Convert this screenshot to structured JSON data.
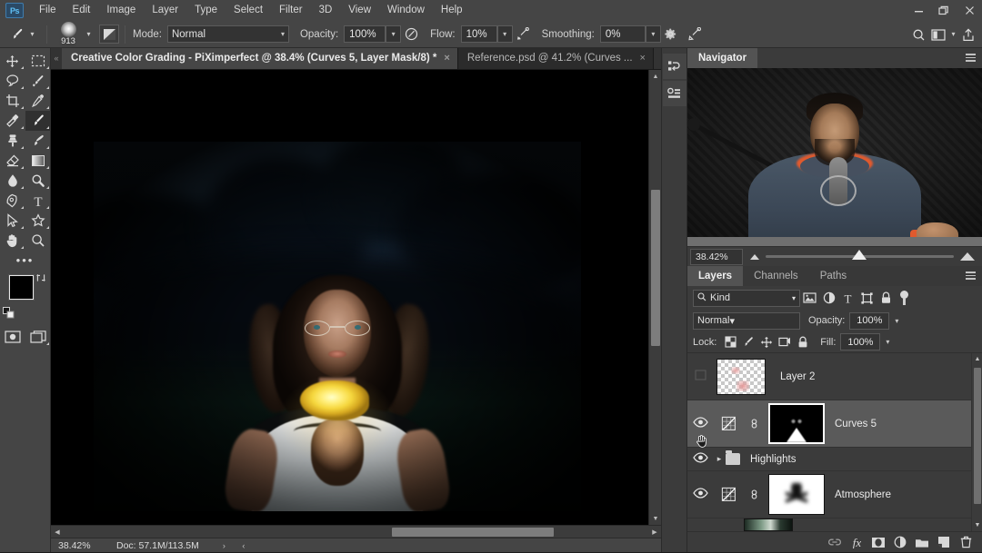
{
  "app": {
    "logo": "Ps",
    "title": "Adobe Photoshop"
  },
  "menu": {
    "items": [
      "File",
      "Edit",
      "Image",
      "Layer",
      "Type",
      "Select",
      "Filter",
      "3D",
      "View",
      "Window",
      "Help"
    ]
  },
  "window_controls": {
    "minimize": "minimize",
    "restore": "restore",
    "close": "close"
  },
  "options_bar": {
    "tool": "brush-tool",
    "brush_size": "913",
    "mode_label": "Mode:",
    "mode_value": "Normal",
    "opacity_label": "Opacity:",
    "opacity_value": "100%",
    "flow_label": "Flow:",
    "flow_value": "10%",
    "smoothing_label": "Smoothing:",
    "smoothing_value": "0%",
    "airbrush": "airbrush-icon",
    "tablet_pressure_opacity": "pressure-opacity-icon",
    "tablet_pressure_size": "pressure-size-icon",
    "symmetry": "symmetry-icon",
    "settings": "gear-icon",
    "right_icons": [
      "search-icon",
      "workspace-icon",
      "share-icon"
    ]
  },
  "tabs": [
    {
      "label": "Creative Color Grading - PiXimperfect @ 38.4% (Curves 5, Layer Mask/8) *",
      "active": true,
      "close": "×"
    },
    {
      "label": "Reference.psd @ 41.2% (Curves ...",
      "active": false,
      "close": "×"
    }
  ],
  "toolbar": {
    "tools": [
      "move-tool",
      "rectangular-marquee-tool",
      "lasso-tool",
      "quick-selection-tool",
      "crop-tool",
      "eyedropper-tool",
      "spot-healing-brush-tool",
      "brush-tool",
      "clone-stamp-tool",
      "history-brush-tool",
      "eraser-tool",
      "gradient-tool",
      "blur-tool",
      "dodge-tool",
      "pen-tool",
      "horizontal-type-tool",
      "path-selection-tool",
      "custom-shape-tool",
      "hand-tool",
      "zoom-tool"
    ],
    "active_tool": "brush-tool",
    "more_tools": "edit-toolbar-icon",
    "foreground_color": "#000000",
    "background_color": "#ffffff",
    "swap_colors": "swap-colors-icon",
    "default_colors": "default-colors-icon",
    "quick_mask": "quick-mask-icon",
    "screen_mode": "screen-mode-icon"
  },
  "dock_icons": [
    "history-panel-icon",
    "properties-panel-icon"
  ],
  "navigator": {
    "tab_label": "Navigator",
    "zoom_value": "38.42%",
    "menu": "panel-menu-icon"
  },
  "layers_panel": {
    "tabs": [
      {
        "label": "Layers",
        "active": true
      },
      {
        "label": "Channels",
        "active": false
      },
      {
        "label": "Paths",
        "active": false
      }
    ],
    "menu": "panel-menu-icon",
    "filter_label": "Kind",
    "filter_icons": [
      "filter-pixel-icon",
      "filter-adjustment-icon",
      "filter-type-icon",
      "filter-shape-icon",
      "filter-smart-object-icon"
    ],
    "filter_toggle": "filter-enable-toggle",
    "blend_mode": "Normal",
    "opacity_label": "Opacity:",
    "opacity_value": "100%",
    "lock_label": "Lock:",
    "lock_icons": [
      "lock-transparent-pixels-icon",
      "lock-image-pixels-icon",
      "lock-position-icon",
      "lock-artboard-nesting-icon",
      "lock-all-icon"
    ],
    "fill_label": "Fill:",
    "fill_value": "100%",
    "layers": [
      {
        "name": "Layer 2",
        "type": "pixel",
        "visible": false,
        "selected": false,
        "thumb": "transparent-checker",
        "linked": false
      },
      {
        "name": "Curves 5",
        "type": "adjustment",
        "visible": true,
        "selected": true,
        "thumb": "curves-adjustment",
        "mask": "black-mask-with-white-triangle",
        "linked": true
      },
      {
        "name": "Highlights",
        "type": "group",
        "visible": true,
        "selected": false,
        "expanded": false
      },
      {
        "name": "Atmosphere",
        "type": "adjustment",
        "visible": true,
        "selected": false,
        "thumb": "curves-adjustment",
        "mask": "white-mask-with-dark-figure",
        "linked": true
      }
    ],
    "footer_icons": [
      "link-layers-icon",
      "layer-style-fx-icon",
      "add-layer-mask-icon",
      "new-adjustment-layer-icon",
      "new-group-icon",
      "new-layer-icon",
      "delete-layer-icon"
    ]
  },
  "status_bar": {
    "zoom": "38.42%",
    "doc": "Doc: 57.1M/113.5M",
    "nav_arrows": "› ‹"
  },
  "canvas": {
    "document": "Creative Color Grading - PiXimperfect",
    "zoom": "38.4%",
    "description": "Dark teal twilight portrait of a woman wearing glasses holding a glowing yellow flower"
  }
}
